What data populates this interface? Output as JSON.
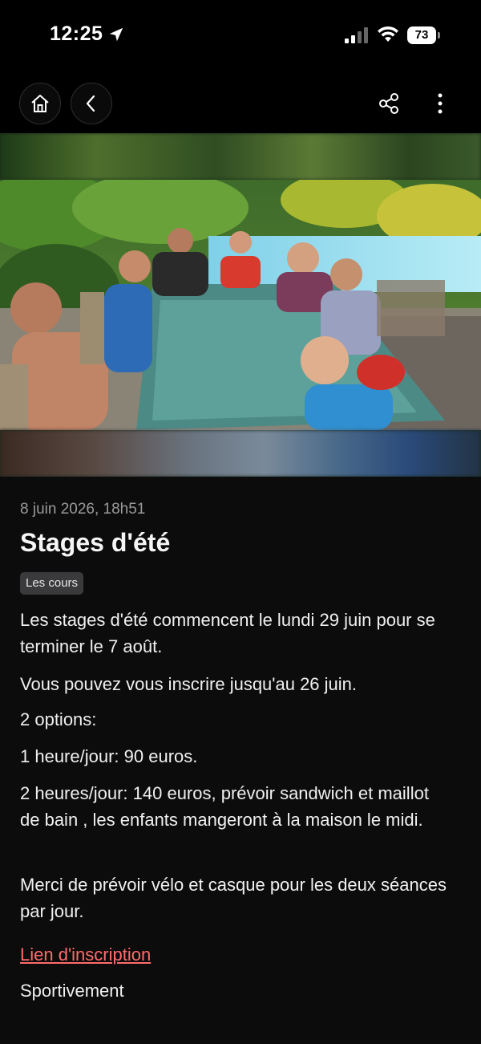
{
  "status_bar": {
    "time": "12:25",
    "battery": "73"
  },
  "nav": {
    "home_icon": "home-icon",
    "back_icon": "chevron-left-icon",
    "share_icon": "share-icon",
    "more_icon": "more-vertical-icon"
  },
  "article": {
    "date": "8 juin 2026, 18h51",
    "title": "Stages d'été",
    "tag": "Les cours",
    "paragraphs": [
      "Les stages d'été commencent le lundi 29 juin pour se terminer le 7 août.",
      "Vous pouvez vous inscrire jusqu'au 26 juin.",
      "2 options:",
      "1 heure/jour: 90 euros.",
      "2 heures/jour: 140 euros, prévoir sandwich et maillot de bain , les enfants mangeront à la maison le midi.",
      "Merci de prévoir vélo et casque pour les deux séances par jour."
    ],
    "link_label": "Lien d'inscription",
    "signature": "Sportivement"
  },
  "colors": {
    "background": "#0c0c0d",
    "link": "#ff6b6b",
    "tag_bg": "#3a3a3c"
  }
}
